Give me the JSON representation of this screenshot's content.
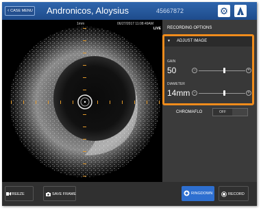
{
  "header": {
    "case_menu_label": "CASE MENU",
    "patient_name": "Andronicos, Aloysius",
    "patient_id": "45667872"
  },
  "image_area": {
    "scale_label": "1mm",
    "date_time": "06/27/2017   11:08:49AM",
    "live_label": "LIVE"
  },
  "right_panel": {
    "recording_options": "RECORDING OPTIONS",
    "adjust_image": {
      "title": "ADJUST IMAGE",
      "gain_label": "GAIN",
      "gain_value": "50",
      "gain_level": 0.55,
      "diameter_label": "DIAMETER",
      "diameter_value": "14mm",
      "diameter_level": 0.55
    },
    "chromaflo": {
      "label": "CHROMAFLO",
      "state": "OFF"
    }
  },
  "bottom_bar": {
    "freeze_label": "FREEZE",
    "save_frame_label": "SAVE FRAME",
    "ringdown_label": "RINGDOWN",
    "record_label": "RECORD"
  },
  "colors": {
    "header_blue": "#1e4b8b",
    "highlight_orange": "#f08c1c",
    "ringdown_blue": "#2e6fd0"
  },
  "icons": [
    "chevron-left-icon",
    "gear-icon",
    "catheter-icon",
    "triangle-down-icon",
    "minus-icon",
    "plus-icon",
    "camera-icon",
    "record-icon",
    "ringdown-icon",
    "freeze-icon"
  ]
}
